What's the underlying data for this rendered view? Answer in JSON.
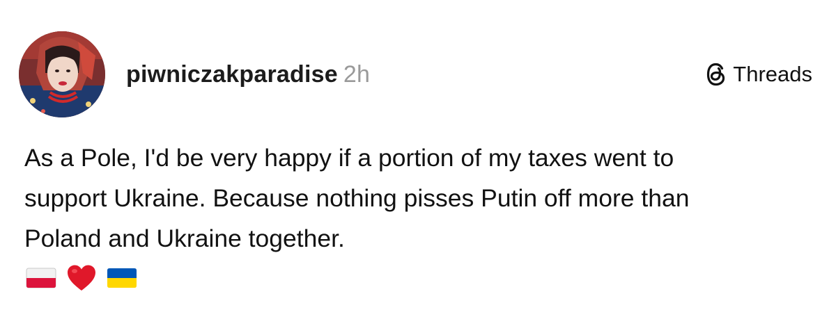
{
  "post": {
    "author": {
      "username": "piwniczakparadise",
      "timestamp": "2h",
      "avatar_icon": "profile-photo"
    },
    "brand": {
      "label": "Threads",
      "icon": "threads-logo-icon"
    },
    "text_lines": [
      "As a Pole, I'd be very happy if a portion of my taxes went to",
      "support Ukraine. Because nothing pisses Putin off more than",
      "Poland and Ukraine together."
    ],
    "emojis": [
      {
        "name": "poland-flag",
        "colors": [
          "#ffffff",
          "#dc143c"
        ]
      },
      {
        "name": "red-heart",
        "colors": [
          "#e0182a"
        ]
      },
      {
        "name": "ukraine-flag",
        "colors": [
          "#0057b7",
          "#ffd700"
        ]
      }
    ]
  }
}
